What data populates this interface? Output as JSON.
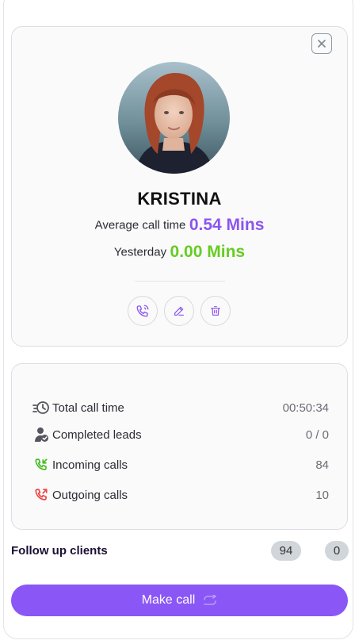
{
  "profile": {
    "name": "KRISTINA",
    "avg_label": "Average call time",
    "avg_value": "0.54 Mins",
    "yesterday_label": "Yesterday",
    "yesterday_value": "0.00 Mins"
  },
  "stats": [
    {
      "label": "Total call time",
      "value": "00:50:34",
      "icon": "clock-speed-icon"
    },
    {
      "label": "Completed leads",
      "value": "0 / 0",
      "icon": "user-check-icon"
    },
    {
      "label": "Incoming calls",
      "value": "84",
      "icon": "incoming-call-icon"
    },
    {
      "label": "Outgoing calls",
      "value": "10",
      "icon": "outgoing-call-icon"
    }
  ],
  "follow_up": {
    "label": "Follow up clients",
    "count_a": "94",
    "count_b": "0"
  },
  "cta": {
    "label": "Make call"
  },
  "colors": {
    "accent": "#8a57f6",
    "avg_value": "#8a55ee",
    "yesterday_value": "#66cc22",
    "incoming": "#44bb22",
    "outgoing": "#ee4444"
  }
}
